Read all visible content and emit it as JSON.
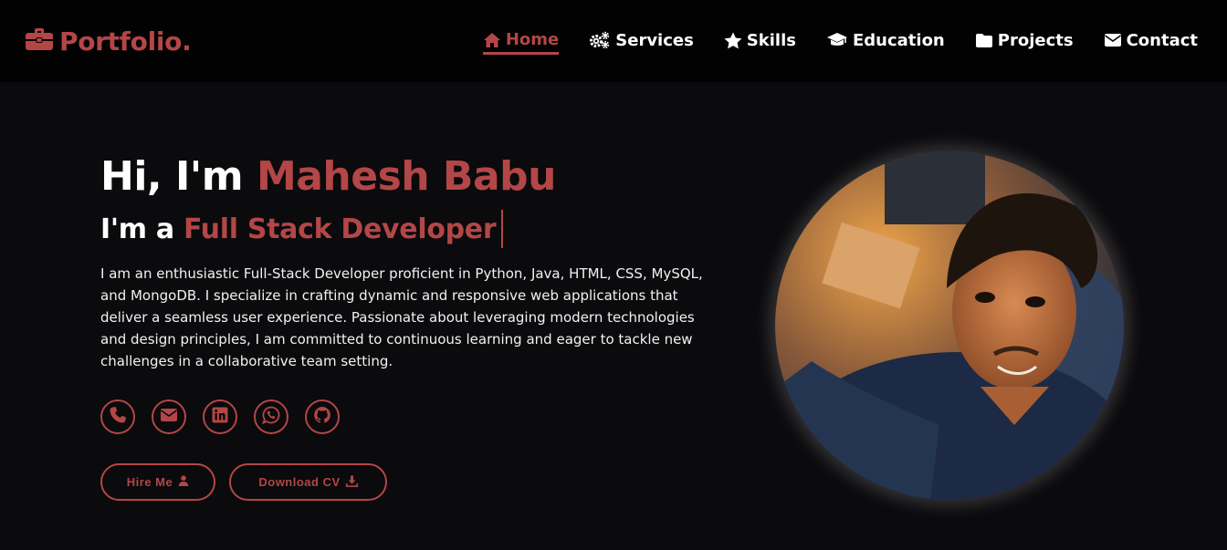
{
  "brand": {
    "name": "Portfolio.",
    "icon": "briefcase-icon"
  },
  "nav": {
    "items": [
      {
        "label": "Home",
        "icon": "home-icon",
        "active": true
      },
      {
        "label": "Services",
        "icon": "gears-icon",
        "active": false
      },
      {
        "label": "Skills",
        "icon": "star-icon",
        "active": false
      },
      {
        "label": "Education",
        "icon": "graduation-cap-icon",
        "active": false
      },
      {
        "label": "Projects",
        "icon": "folder-icon",
        "active": false
      },
      {
        "label": "Contact",
        "icon": "envelope-icon",
        "active": false
      }
    ]
  },
  "hero": {
    "greeting_prefix": "Hi, I'm ",
    "name": "Mahesh Babu",
    "role_prefix": "I'm a ",
    "role": "Full Stack Developer",
    "bio": "I am an enthusiastic Full-Stack Developer proficient in Python, Java, HTML, CSS, MySQL, and MongoDB. I specialize in crafting dynamic and responsive web applications that deliver a seamless user experience. Passionate about leveraging modern technologies and design principles, I am committed to continuous learning and eager to tackle new challenges in a collaborative team setting.",
    "socials": [
      "phone-icon",
      "envelope-icon",
      "linkedin-icon",
      "whatsapp-icon",
      "github-icon"
    ],
    "hire_label": "Hire Me",
    "cv_label": "Download CV"
  },
  "colors": {
    "accent": "#b34647",
    "background": "#0b0a0c",
    "navbar": "#020203",
    "text": "#ffffff"
  }
}
